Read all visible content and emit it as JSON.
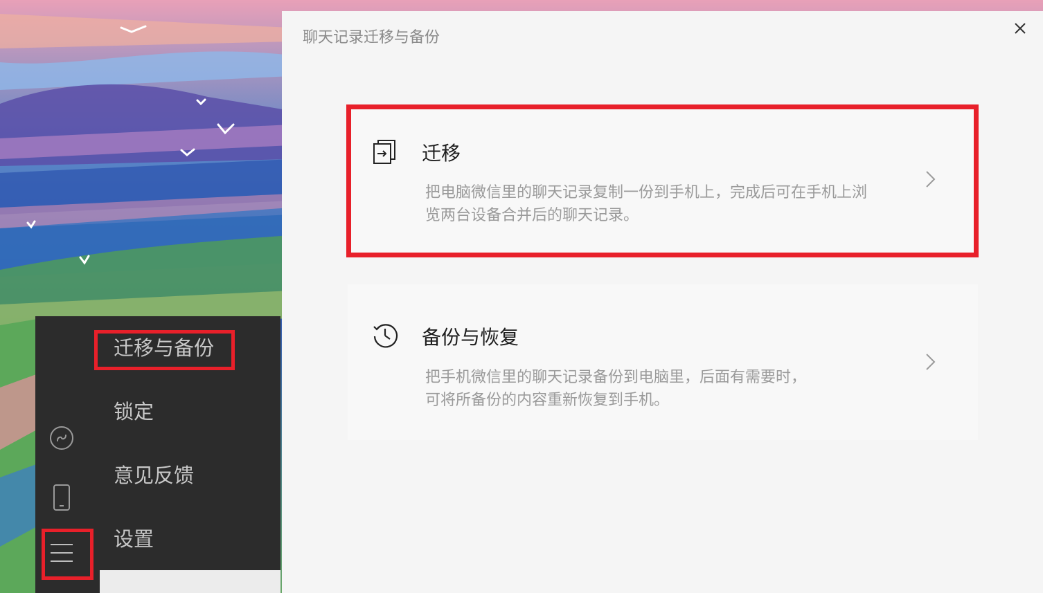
{
  "dialog": {
    "title": "聊天记录迁移与备份",
    "close_icon": "close-icon",
    "options": [
      {
        "title": "迁移",
        "desc_lines": [
          "把电脑微信里的聊天记录复制一份到手机上，完成后可在手机上浏",
          "览两台设备合并后的聊天记录。"
        ],
        "icon": "migrate-icon",
        "highlighted": true
      },
      {
        "title": "备份与恢复",
        "desc_lines": [
          "把手机微信里的聊天记录备份到电脑里，后面有需要时，",
          "可将所备份的内容重新恢复到手机。"
        ],
        "icon": "history-icon",
        "highlighted": false
      }
    ]
  },
  "menu": {
    "items": [
      "迁移与备份",
      "锁定",
      "意见反馈",
      "设置"
    ]
  },
  "sidebar": {
    "icons": [
      "mini-program-icon",
      "phone-icon",
      "menu-icon"
    ]
  },
  "colors": {
    "highlight": "#e8202a",
    "sidebar_bg": "#2c2c2c",
    "dialog_bg": "#f5f5f5",
    "card_bg": "#f8f8f8"
  }
}
